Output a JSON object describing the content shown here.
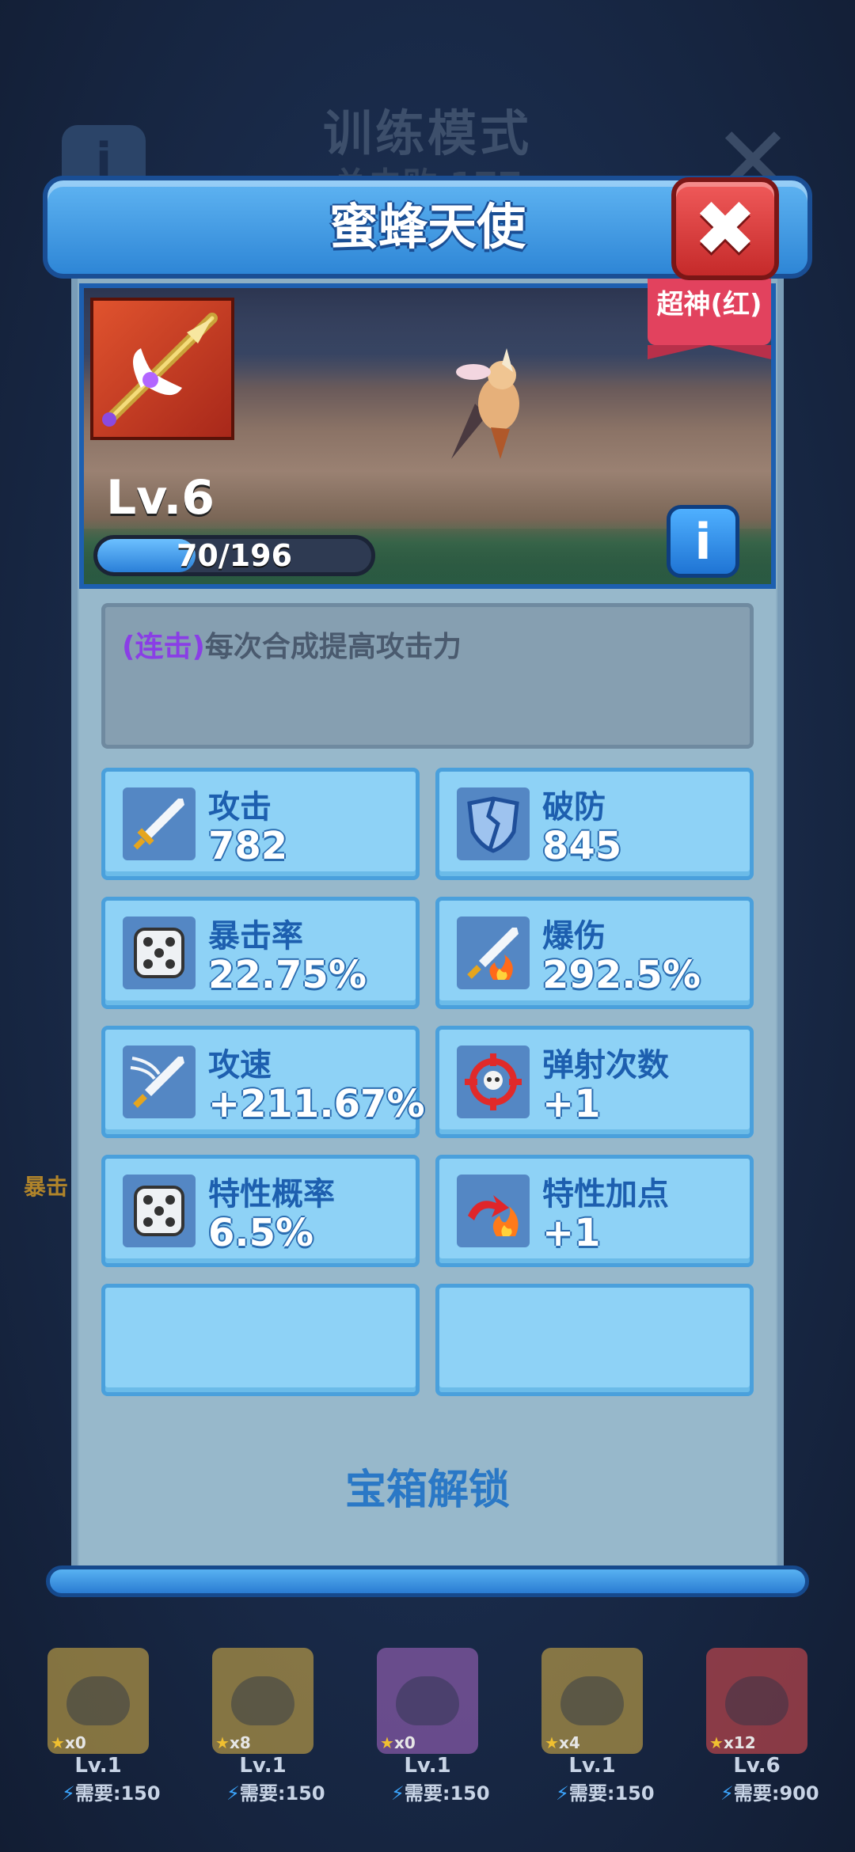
{
  "background": {
    "title": "训练模式",
    "subtitle": "总击败 177",
    "side_text": "暴击"
  },
  "dialog": {
    "title": "蜜蜂天使",
    "close_label": "✖",
    "rarity": "超神(红)",
    "level": "Lv.6",
    "exp_text": "70/196",
    "exp_progress": 0.357,
    "info_label": "i",
    "description_tag": "(连击)",
    "description": "每次合成提高攻击力",
    "unlock_text": "宝箱解锁"
  },
  "stats": [
    {
      "label": "攻击",
      "value": "782",
      "icon": "sword-icon"
    },
    {
      "label": "破防",
      "value": "845",
      "icon": "broken-shield-icon"
    },
    {
      "label": "暴击率",
      "value": "22.75%",
      "icon": "dice-icon"
    },
    {
      "label": "爆伤",
      "value": "292.5%",
      "icon": "flaming-sword-icon"
    },
    {
      "label": "攻速",
      "value": "+211.67%",
      "icon": "speed-sword-icon"
    },
    {
      "label": "弹射次数",
      "value": "+1",
      "icon": "target-skull-icon"
    },
    {
      "label": "特性概率",
      "value": "6.5%",
      "icon": "dice-icon"
    },
    {
      "label": "特性加点",
      "value": "+1",
      "icon": "fire-arrow-icon"
    }
  ],
  "roster": [
    {
      "count": "x0",
      "level": "Lv.1",
      "cost": "需要:150",
      "color": "#c9a646"
    },
    {
      "count": "x8",
      "level": "Lv.1",
      "cost": "需要:150",
      "color": "#c9a646"
    },
    {
      "count": "x0",
      "level": "Lv.1",
      "cost": "需要:150",
      "color": "#9b62b8"
    },
    {
      "count": "x4",
      "level": "Lv.1",
      "cost": "需要:150",
      "color": "#c9a646"
    },
    {
      "count": "x12",
      "level": "Lv.6",
      "cost": "需要:900",
      "color": "#d24a4e"
    }
  ]
}
